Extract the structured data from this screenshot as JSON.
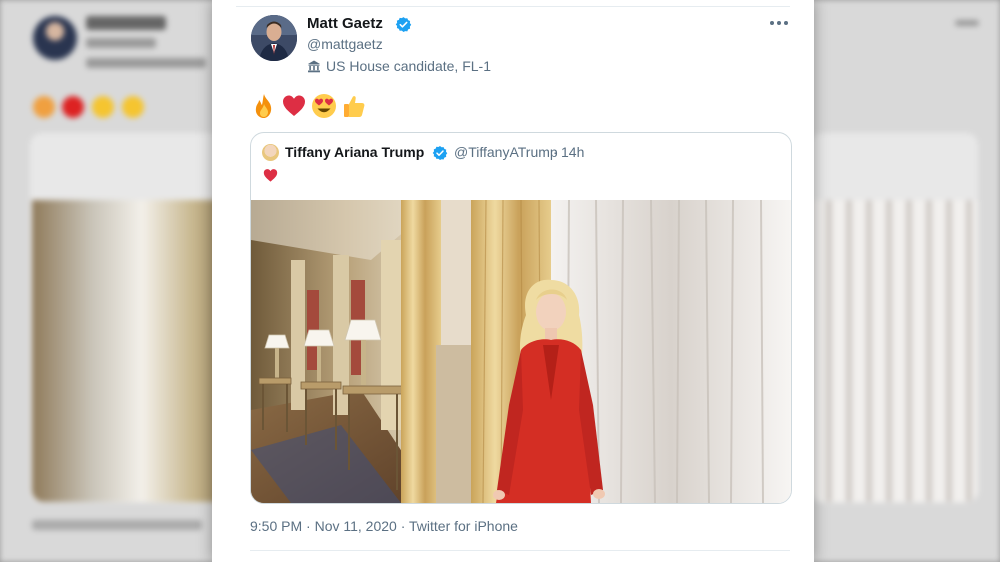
{
  "tweet": {
    "author_name": "Matt Gaetz",
    "author_handle": "@mattgaetz",
    "bio_label": "US House candidate, FL-1",
    "emojis": [
      "fire-emoji",
      "red-heart-emoji",
      "heart-eyes-emoji",
      "thumbs-up-emoji"
    ],
    "timestamp": "9:50 PM · Nov 11, 2020 · Twitter for iPhone"
  },
  "quoted": {
    "author_name": "Tiffany Ariana Trump",
    "author_handle": "@TiffanyATrump",
    "separator": " · ",
    "age": "14h",
    "text_emoji": "red-heart-emoji"
  },
  "colors": {
    "verified": "#1da1f2",
    "secondary_text": "#5b7083",
    "primary_text": "#14171a",
    "border": "#cfd9de"
  }
}
